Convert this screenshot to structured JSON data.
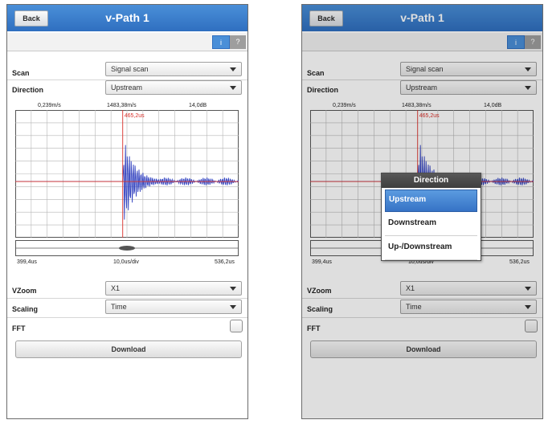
{
  "app": {
    "title": "v-Path 1",
    "back_label": "Back",
    "tab_info": "i",
    "tab_help": "?"
  },
  "form": {
    "scan_label": "Scan",
    "scan_value": "Signal scan",
    "direction_label": "Direction",
    "direction_value": "Upstream",
    "vzoom_label": "VZoom",
    "vzoom_value": "X1",
    "scaling_label": "Scaling",
    "scaling_value": "Time",
    "fft_label": "FFT",
    "fft_checked": false,
    "download_label": "Download"
  },
  "chart": {
    "top_left": "0,239m/s",
    "top_center": "1483,38m/s",
    "top_right": "14,0dB",
    "marker_label": "465,2us",
    "bottom_left": "399,4us",
    "bottom_center": "10,0us/div",
    "bottom_right": "536,2us"
  },
  "chart_data": {
    "type": "line",
    "x_range": [
      399.4,
      536.2
    ],
    "x_unit": "us",
    "marker_x": 465.2,
    "grid": true
  },
  "dialog": {
    "title": "Direction",
    "options": [
      "Upstream",
      "Downstream",
      "Up-/Downstream"
    ],
    "selected": "Upstream"
  },
  "colors": {
    "titlebar": "#3a7fd0",
    "signal": "#2f3fbf",
    "marker": "#d9302a",
    "grid": "#b5b5b5"
  }
}
